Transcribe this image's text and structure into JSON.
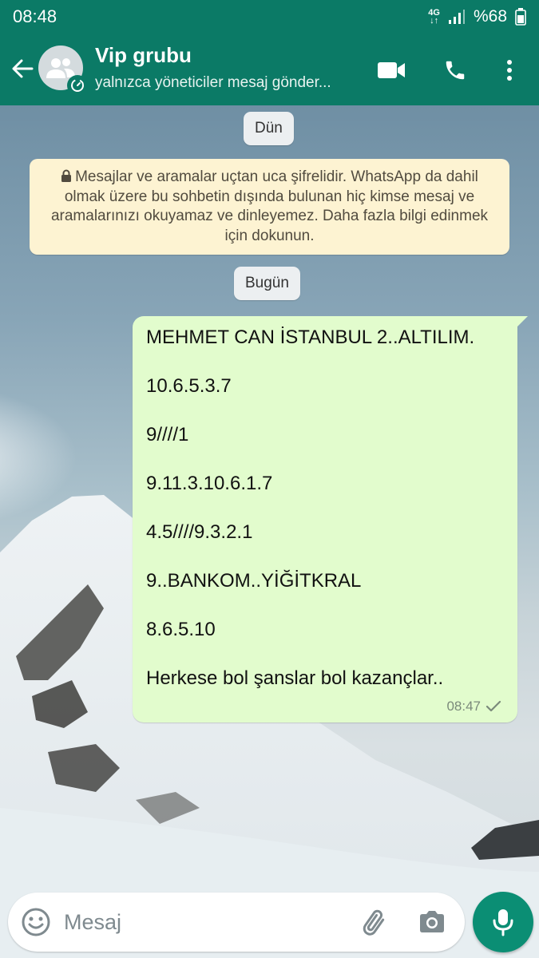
{
  "status_bar": {
    "time": "08:48",
    "network_top": "4G",
    "network_bottom": "↓↑",
    "battery": "%68"
  },
  "header": {
    "title": "Vip grubu",
    "subtitle": "yalnızca yöneticiler mesaj gönder..."
  },
  "chat": {
    "date_yesterday": "Dün",
    "encryption_notice": "Mesajlar ve aramalar uçtan uca şifrelidir. WhatsApp da dahil olmak üzere bu sohbetin dışında bulunan hiç kimse mesaj ve aramalarınızı okuyamaz ve dinleyemez. Daha fazla bilgi edinmek için dokunun.",
    "date_today": "Bugün",
    "message": {
      "lines": [
        "MEHMET CAN İSTANBUL  2..ALTILIM.",
        "10.6.5.3.7",
        "9////1",
        "9.11.3.10.6.1.7",
        "4.5////9.3.2.1",
        "9..BANKOM..YİĞİTKRAL",
        "8.6.5.10",
        "Herkese  bol şanslar bol kazançlar.."
      ],
      "time": "08:47",
      "status_icon": "single-check-icon"
    }
  },
  "composer": {
    "placeholder": "Mesaj"
  },
  "icons": {
    "back": "arrow-left-icon",
    "video": "video-call-icon",
    "call": "phone-icon",
    "more": "more-vertical-icon",
    "emoji": "emoji-icon",
    "attach": "paperclip-icon",
    "camera": "camera-icon",
    "mic": "microphone-icon"
  },
  "colors": {
    "header": "#0b7a66",
    "outgoing_bubble": "#e2fccd",
    "notice": "#fdf3d2",
    "mic_button": "#0b8e74"
  }
}
